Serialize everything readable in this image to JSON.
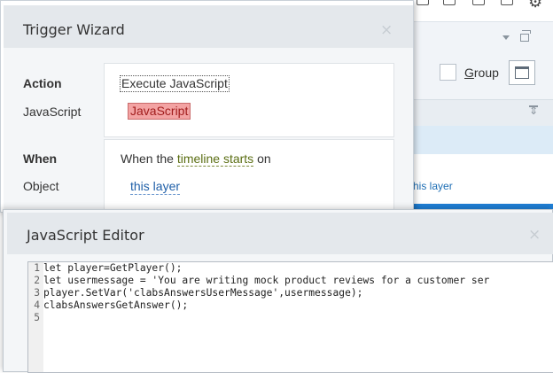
{
  "background_panel": {
    "group_label": "Group",
    "group_label_access_key": "G",
    "group_label_rest": "roup",
    "layer_link_partial": "his layer",
    "toolbar_icons": [
      "device-icon",
      "device-icon",
      "device-icon",
      "device-icon",
      "device-icon",
      "gear-icon"
    ]
  },
  "trigger_wizard": {
    "title": "Trigger Wizard",
    "close_glyph": "×",
    "action_label": "Action",
    "action_value": "Execute JavaScript",
    "javascript_label": "JavaScript",
    "javascript_value": "JavaScript",
    "when_label": "When",
    "when_prefix": "When the ",
    "when_link": "timeline starts",
    "when_suffix": " on",
    "object_label": "Object",
    "object_value": "this layer"
  },
  "js_editor": {
    "title": "JavaScript Editor",
    "close_glyph": "×",
    "lines": [
      {
        "num": "1",
        "code": "let player=GetPlayer();"
      },
      {
        "num": "2",
        "code": "let usermessage = 'You are writing mock product reviews for a customer ser"
      },
      {
        "num": "3",
        "code": "player.SetVar('clabsAnswersUserMessage',usermessage);"
      },
      {
        "num": "4",
        "code": "clabsAnswersGetAnswer();"
      },
      {
        "num": "5",
        "code": ""
      }
    ]
  },
  "colors": {
    "title_bar": "#e4e8ec",
    "dialog_body": "#f4f6f8",
    "accent_blue": "#1f7fd6",
    "js_chip_bg": "#f3a3a3",
    "when_link": "#5b6e13",
    "object_link": "#1f5fa8"
  }
}
